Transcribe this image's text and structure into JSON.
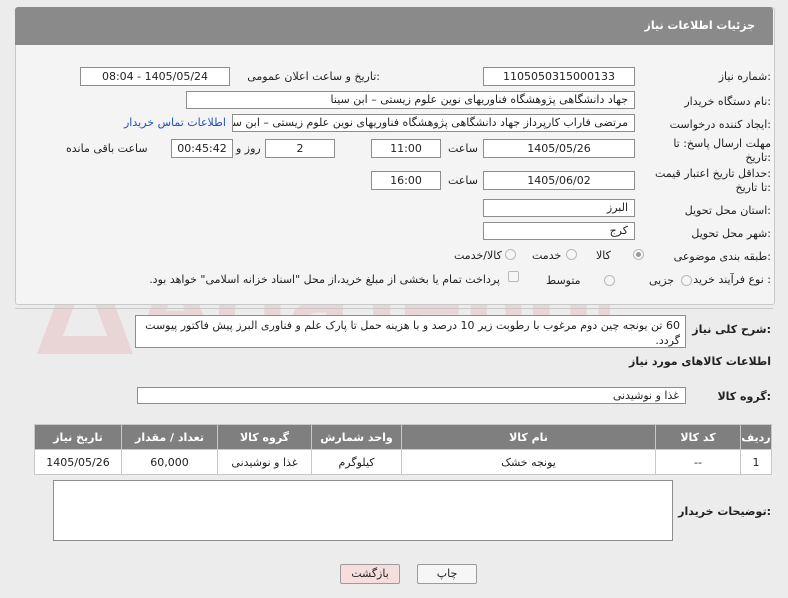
{
  "panel": {
    "title": "جزئیات اطلاعات نیاز"
  },
  "fields": {
    "need_number_label": "شماره نیاز:",
    "need_number": "1105050315000133",
    "announce_label": "تاریخ و ساعت اعلان عمومی:",
    "announce_value": "1405/05/24 - 08:04",
    "buyer_org_label": "نام دستگاه خریدار:",
    "buyer_org": "جهاد دانشگاهی پژوهشگاه فناوریهای نوین علوم زیستی – ابن سینا",
    "creator_label": "ایجاد کننده درخواست:",
    "creator": "مرتضی فاراب کارپرداز جهاد دانشگاهی پژوهشگاه فناوریهای نوین علوم زیستی – ابن سینا",
    "buyer_contact_link": "اطلاعات تماس خریدار",
    "deadline_label_1": "مهلت ارسال پاسخ: تا",
    "deadline_label_2": "تاریخ:",
    "deadline_date": "1405/05/26",
    "hour_label": "ساعت",
    "deadline_time": "11:00",
    "days_value": "2",
    "days_label": "روز و",
    "remaining_time": "00:45:42",
    "remaining_label": "ساعت باقی مانده",
    "price_validity_label_1": "حداقل تاریخ اعتبار قیمت:",
    "price_validity_label_2": "تا تاریخ:",
    "validity_date": "1405/06/02",
    "validity_time": "16:00",
    "province_label": "استان محل تحویل:",
    "province": "البرز",
    "city_label": "شهر محل تحویل:",
    "city": "کرج",
    "category_label": "طبقه بندی موضوعی:",
    "category_options": [
      "کالا",
      "خدمت",
      "کالا/خدمت"
    ],
    "category_selected": "کالا",
    "purchase_type_label": "نوع فرآیند خرید :",
    "purchase_options": [
      "جزیی",
      "متوسط"
    ],
    "payment_note": "پرداخت تمام یا بخشی از مبلغ خرید،از محل \"اسناد خزانه اسلامی\" خواهد بود."
  },
  "description": {
    "label": "شرح کلی نیاز:",
    "text": "60 تن یونجه چین دوم مرغوب با رطوبت زیر 10 درصد و با هزینه حمل تا پارک علم و فناوری البرز پیش فاکتور پیوست گردد."
  },
  "goods": {
    "section_title": "اطلاعات کالاهای مورد نیاز",
    "group_label": "گروه کالا:",
    "group_value": "غذا و نوشیدنی",
    "columns": [
      "ردیف",
      "کد کالا",
      "نام کالا",
      "واحد شمارش",
      "گروه کالا",
      "تعداد / مقدار",
      "تاریخ نیاز"
    ],
    "rows": [
      [
        "1",
        "--",
        "یونجه خشک",
        "کیلوگرم",
        "غذا و نوشیدنی",
        "60,000",
        "1405/05/26"
      ]
    ]
  },
  "buyer_notes": {
    "label": "توضیحات خریدار:",
    "text": ""
  },
  "buttons": {
    "print": "چاپ",
    "back": "بازگشت"
  },
  "watermark": {
    "text": "AriaTender.neT"
  },
  "colors": {
    "header_bg": "#8a8a8a",
    "link": "#1f52b5",
    "back_button_bg": "#f7dede"
  }
}
